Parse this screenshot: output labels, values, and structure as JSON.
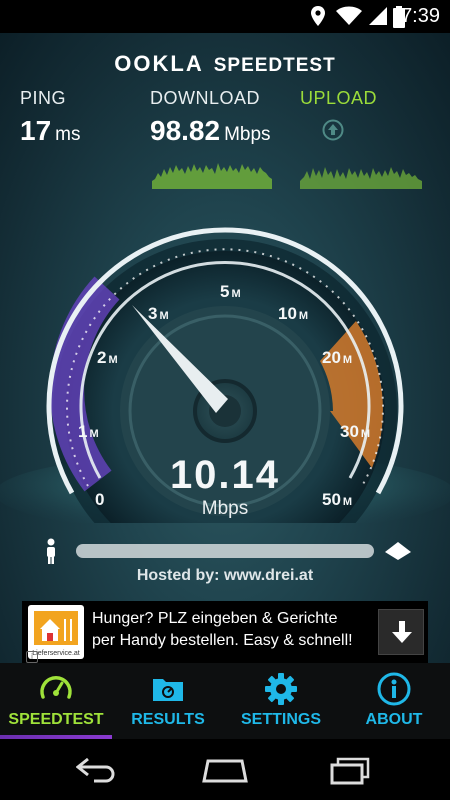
{
  "status_bar": {
    "time": "7:39"
  },
  "header": {
    "brand_ookla": "OOKLA",
    "brand_speedtest": "SPEEDTEST"
  },
  "stats": {
    "ping": {
      "label": "PING",
      "value": "17",
      "unit": "ms"
    },
    "download": {
      "label": "DOWNLOAD",
      "value": "98.82",
      "unit": "Mbps"
    },
    "upload": {
      "label": "UPLOAD"
    }
  },
  "gauge": {
    "ticks": [
      "0",
      "1",
      "2",
      "3",
      "5",
      "10",
      "20",
      "30",
      "50"
    ],
    "tick_unit": "M",
    "reading": "10.14",
    "reading_unit": "Mbps",
    "progress": 0
  },
  "host": {
    "text": "Hosted by: www.drei.at"
  },
  "ad": {
    "line1": "Hunger? PLZ eingeben & Gerichte",
    "line2": "per Handy bestellen. Easy & schnell!",
    "logo_text": "Lieferservice.at"
  },
  "tabs": [
    {
      "label": "SPEEDTEST",
      "icon": "speedometer-icon",
      "active": true
    },
    {
      "label": "RESULTS",
      "icon": "folder-icon",
      "active": false
    },
    {
      "label": "SETTINGS",
      "icon": "gear-icon",
      "active": false
    },
    {
      "label": "ABOUT",
      "icon": "info-icon",
      "active": false
    }
  ],
  "colors": {
    "accent_green": "#9fe23a",
    "accent_blue": "#1fb8e8",
    "gauge_orange": "#e07a1e",
    "gauge_purple": "#7a3fd0"
  }
}
